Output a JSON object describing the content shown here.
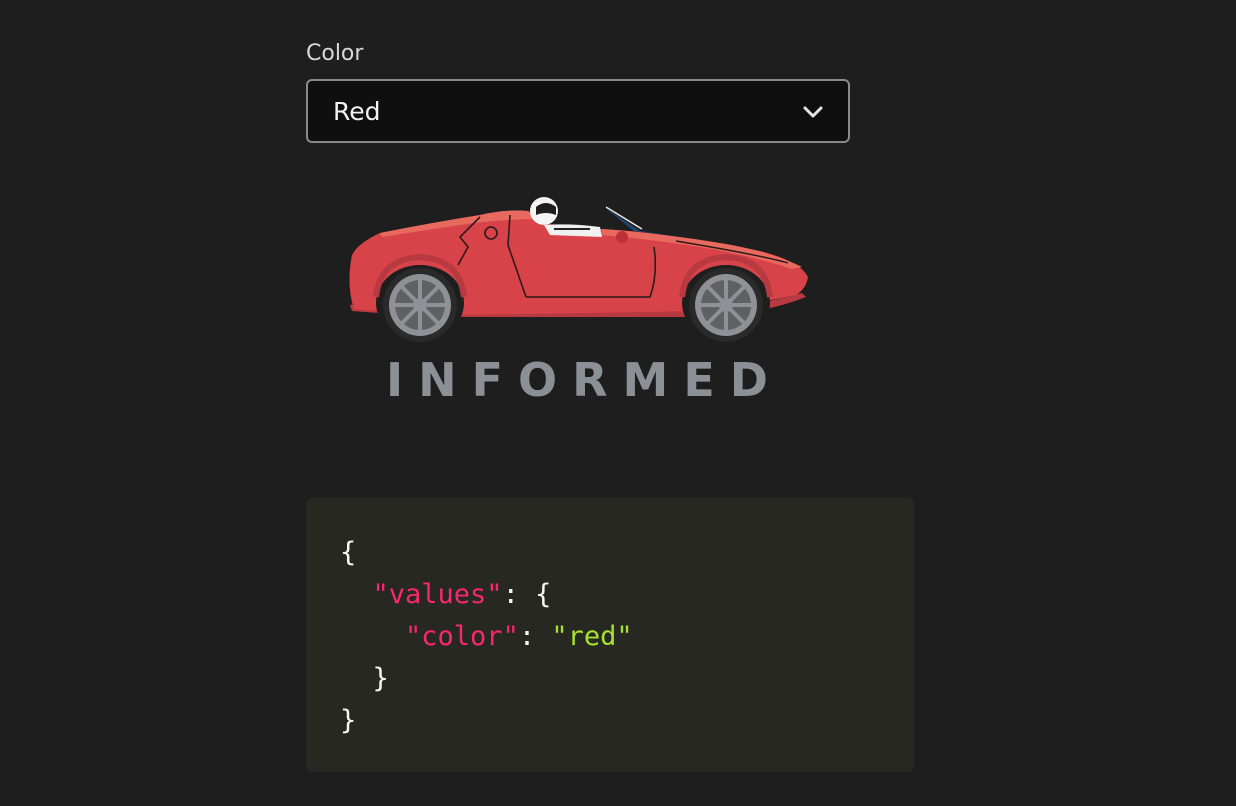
{
  "field": {
    "label": "Color",
    "selected": "Red"
  },
  "logo": {
    "text": "INFORMED",
    "car_color": "#d8434a",
    "text_color": "#8b9097"
  },
  "code": {
    "open_brace": "{",
    "values_key": "\"values\"",
    "colon": ":",
    "inner_open": "{",
    "color_key": "\"color\"",
    "color_value": "\"red\"",
    "inner_close": "}",
    "close_brace": "}"
  },
  "icons": {
    "select_chevron": "chevron-down-icon"
  }
}
